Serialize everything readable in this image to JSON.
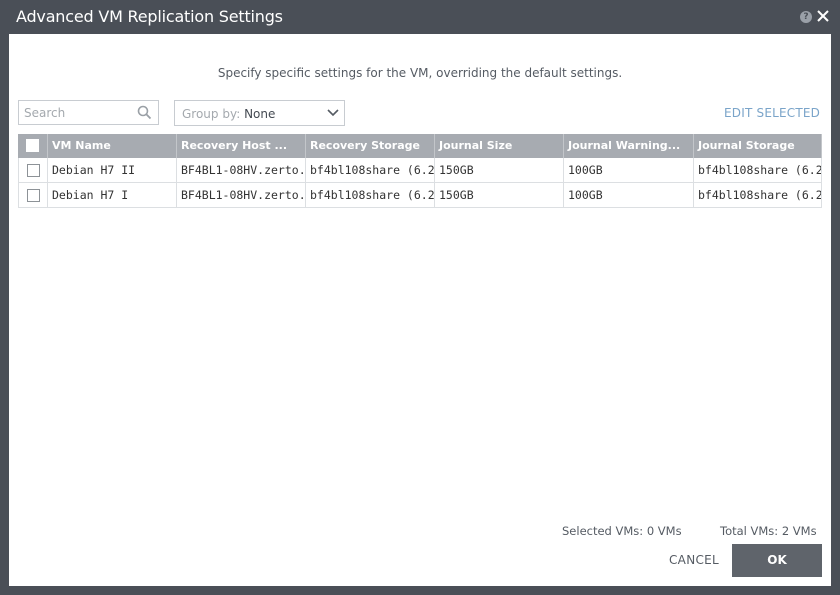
{
  "dialog": {
    "title": "Advanced VM Replication Settings",
    "help_icon": "question-icon",
    "close_icon": "close-icon"
  },
  "subtitle": "Specify specific settings for the VM, overriding the default settings.",
  "toolbar": {
    "search_placeholder": "Search",
    "group_by_label": "Group by:",
    "group_by_value": "None",
    "edit_selected": "EDIT SELECTED"
  },
  "grid": {
    "columns": [
      "VM Name",
      "Recovery Host ...",
      "Recovery Storage",
      "Journal Size",
      "Journal Warning...",
      "Journal Storage"
    ],
    "rows": [
      {
        "vm_name": "Debian H7 II",
        "recovery_host": "BF4BL1-08HV.zerto...",
        "recovery_storage": "bf4bl108share (6.2...",
        "journal_size": "150GB",
        "journal_warning": "100GB",
        "journal_storage": "bf4bl108share (6.2..."
      },
      {
        "vm_name": "Debian H7 I",
        "recovery_host": "BF4BL1-08HV.zerto...",
        "recovery_storage": "bf4bl108share (6.2...",
        "journal_size": "150GB",
        "journal_warning": "100GB",
        "journal_storage": "bf4bl108share (6.2..."
      }
    ]
  },
  "footer": {
    "selected_vms": "Selected VMs: 0 VMs",
    "total_vms": "Total VMs: 2 VMs",
    "cancel": "CANCEL",
    "ok": "OK"
  },
  "colors": {
    "frame": "#4a4f57",
    "header": "#a7abb1",
    "link": "#7aa4c9",
    "ok_button": "#5f646b"
  }
}
